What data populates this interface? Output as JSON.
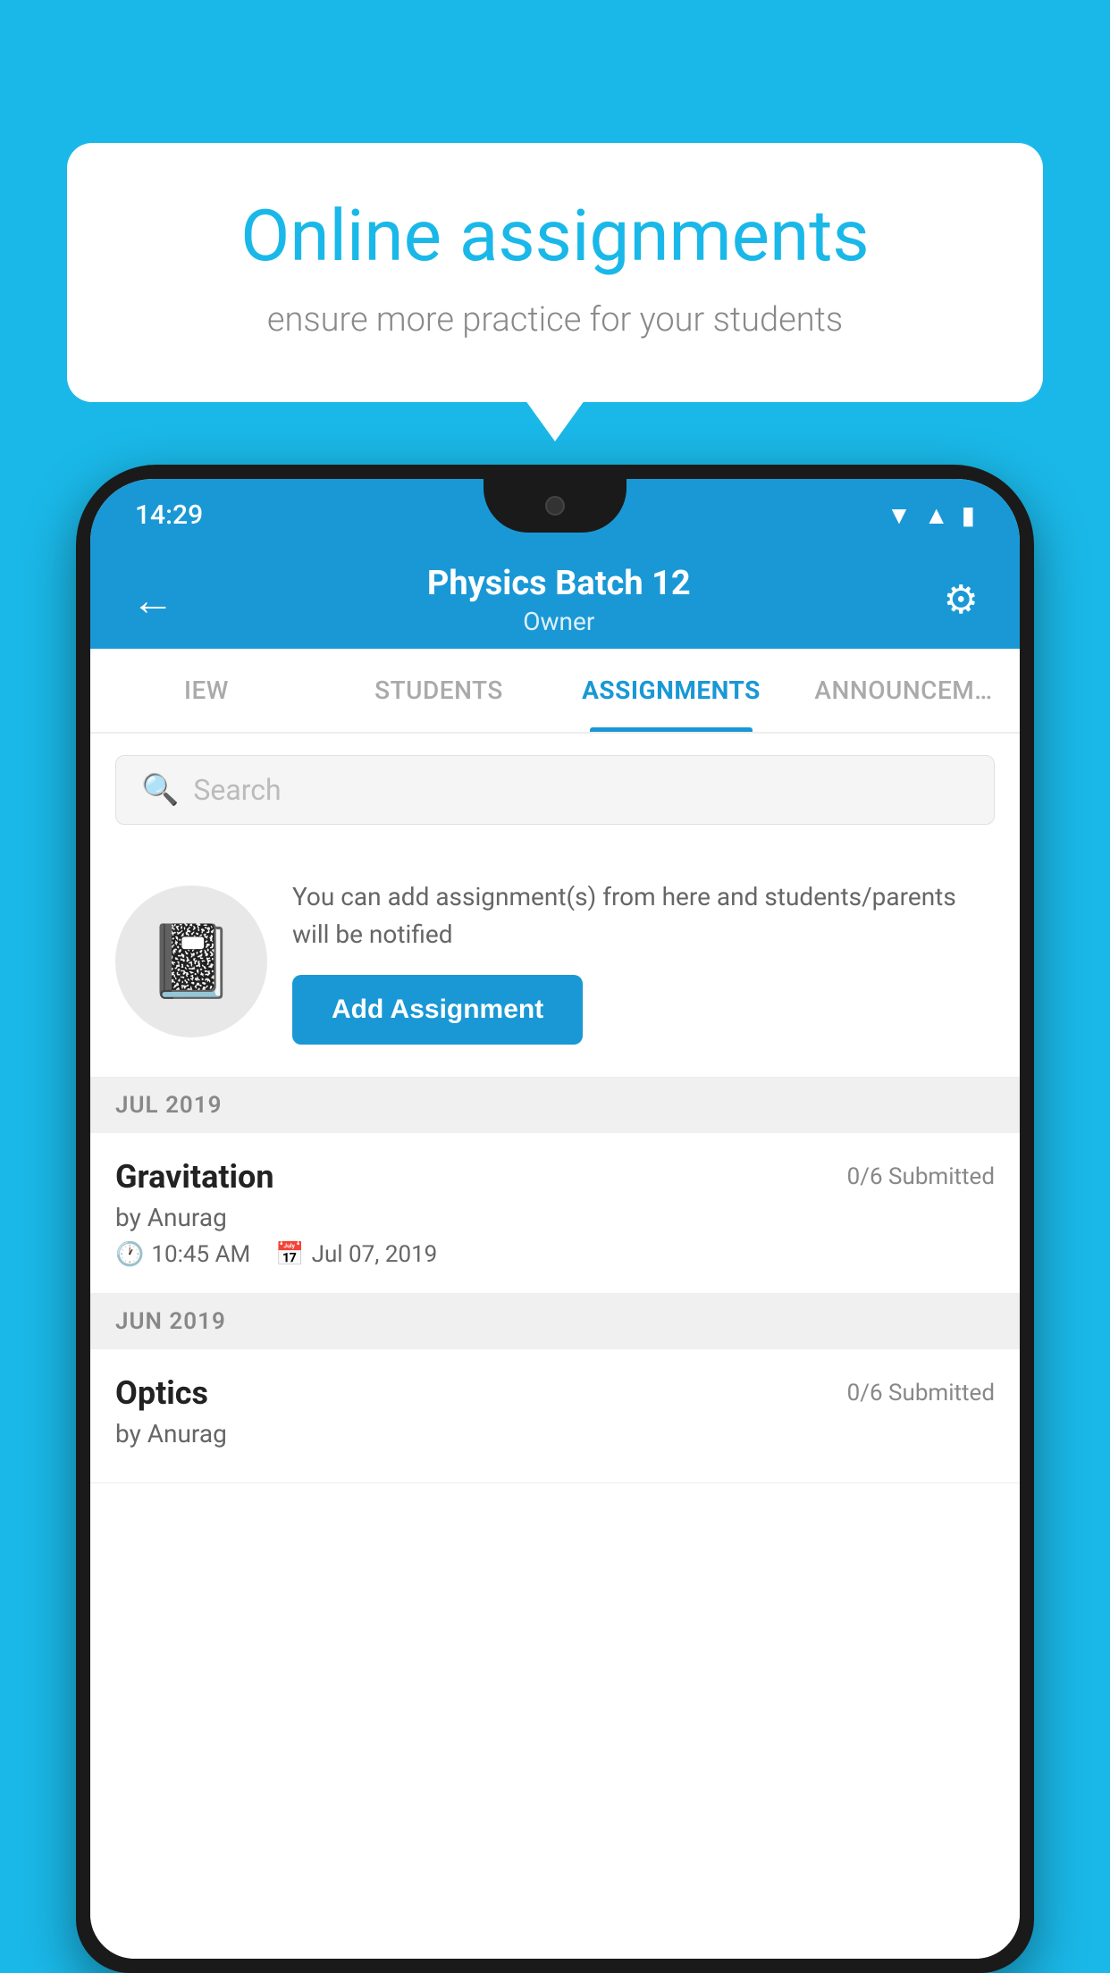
{
  "background_color": "#1ab8e8",
  "speech_bubble": {
    "title": "Online assignments",
    "subtitle": "ensure more practice for your students"
  },
  "status_bar": {
    "time": "14:29",
    "icons": [
      "wifi",
      "signal",
      "battery"
    ]
  },
  "toolbar": {
    "title": "Physics Batch 12",
    "subtitle": "Owner",
    "back_label": "←",
    "settings_label": "⚙"
  },
  "tabs": [
    {
      "label": "IEW",
      "active": false
    },
    {
      "label": "STUDENTS",
      "active": false
    },
    {
      "label": "ASSIGNMENTS",
      "active": true
    },
    {
      "label": "ANNOUNCEM…",
      "active": false
    }
  ],
  "search": {
    "placeholder": "Search"
  },
  "promo": {
    "description": "You can add assignment(s) from here and students/parents will be notified",
    "button_label": "Add Assignment"
  },
  "assignment_groups": [
    {
      "month": "JUL 2019",
      "assignments": [
        {
          "name": "Gravitation",
          "submitted": "0/6 Submitted",
          "by": "by Anurag",
          "time": "10:45 AM",
          "date": "Jul 07, 2019"
        }
      ]
    },
    {
      "month": "JUN 2019",
      "assignments": [
        {
          "name": "Optics",
          "submitted": "0/6 Submitted",
          "by": "by Anurag",
          "time": "",
          "date": ""
        }
      ]
    }
  ]
}
